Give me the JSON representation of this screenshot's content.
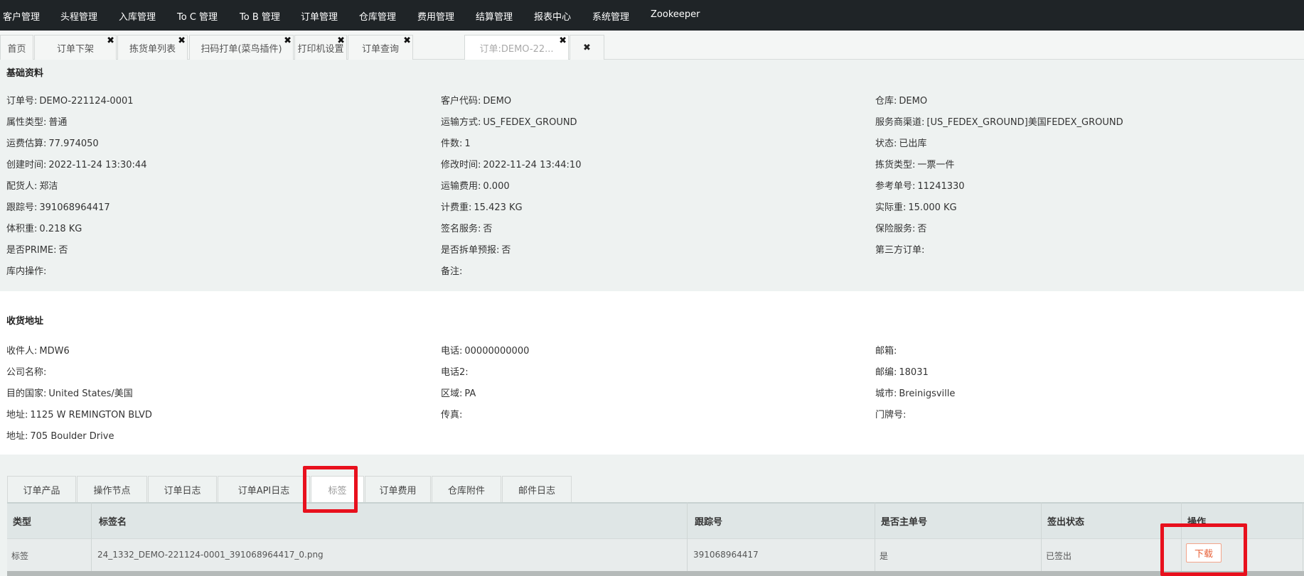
{
  "top_nav": [
    "客户管理",
    "头程管理",
    "入库管理",
    "To C 管理",
    "To B 管理",
    "订单管理",
    "仓库管理",
    "费用管理",
    "结算管理",
    "报表中心",
    "系统管理",
    "Zookeeper"
  ],
  "tabs": [
    {
      "label": "首页",
      "closable": false
    },
    {
      "label": "订单下架",
      "closable": true
    },
    {
      "label": "拣货单列表",
      "closable": true
    },
    {
      "label": "扫码打单(菜鸟插件)",
      "closable": true
    },
    {
      "label": "打印机设置",
      "closable": true
    },
    {
      "label": "订单查询",
      "closable": true
    },
    {
      "label": "订单:DEMO-22...",
      "closable": true,
      "active": true
    },
    {
      "label": "✖",
      "closable": false
    }
  ],
  "close_glyph": "✖",
  "basic": {
    "title": "基础资料",
    "fields": [
      [
        "订单号:",
        "DEMO-221124-0001"
      ],
      [
        "客户代码:",
        "DEMO"
      ],
      [
        "仓库:",
        "DEMO"
      ],
      [
        "属性类型:",
        "普通"
      ],
      [
        "运输方式:",
        "US_FEDEX_GROUND"
      ],
      [
        "服务商渠道:",
        "[US_FEDEX_GROUND]美国FEDEX_GROUND"
      ],
      [
        "运费估算:",
        "77.974050"
      ],
      [
        "件数:",
        "1"
      ],
      [
        "状态:",
        "已出库"
      ],
      [
        "创建时间:",
        "2022-11-24 13:30:44"
      ],
      [
        "修改时间:",
        "2022-11-24 13:44:10"
      ],
      [
        "拣货类型:",
        "一票一件"
      ],
      [
        "配货人:",
        "郑洁"
      ],
      [
        "运输费用:",
        "0.000"
      ],
      [
        "参考单号:",
        "11241330"
      ],
      [
        "跟踪号:",
        "391068964417"
      ],
      [
        "计费重:",
        "15.423 KG"
      ],
      [
        "实际重:",
        "15.000 KG"
      ],
      [
        "体积重:",
        "0.218 KG"
      ],
      [
        "签名服务:",
        "否"
      ],
      [
        "保险服务:",
        "否"
      ],
      [
        "是否PRIME:",
        "否"
      ],
      [
        "是否拆单预报:",
        "否"
      ],
      [
        "第三方订单:",
        ""
      ],
      [
        "库内操作:",
        ""
      ],
      [
        "备注:",
        ""
      ],
      [
        "",
        ""
      ]
    ]
  },
  "address": {
    "title": "收货地址",
    "fields": [
      [
        "收件人:",
        "MDW6"
      ],
      [
        "电话:",
        "00000000000"
      ],
      [
        "邮箱:",
        ""
      ],
      [
        "公司名称:",
        ""
      ],
      [
        "电话2:",
        ""
      ],
      [
        "邮编:",
        "18031"
      ],
      [
        "目的国家:",
        "United States/美国"
      ],
      [
        "区域:",
        "PA"
      ],
      [
        "城市:",
        "Breinigsville"
      ],
      [
        "地址:",
        "1125 W REMINGTON BLVD"
      ],
      [
        "传真:",
        ""
      ],
      [
        "门牌号:",
        ""
      ],
      [
        "地址:",
        "705 Boulder Drive"
      ],
      [
        "",
        ""
      ],
      [
        "",
        ""
      ]
    ]
  },
  "bottom_tabs": [
    "订单产品",
    "操作节点",
    "订单日志",
    "订单API日志",
    "标签",
    "订单费用",
    "仓库附件",
    "邮件日志"
  ],
  "bottom_tabs_active": "标签",
  "table": {
    "headers": [
      "类型",
      "标签名",
      "跟踪号",
      "是否主单号",
      "签出状态",
      "操作"
    ],
    "rows": [
      [
        "标签",
        "24_1332_DEMO-221124-0001_391068964417_0.png",
        "391068964417",
        "是",
        "已签出",
        "下载"
      ]
    ]
  },
  "colors": {
    "highlight": "#e8101d",
    "nav_bg": "#1f2427",
    "download": "#e8623a"
  }
}
